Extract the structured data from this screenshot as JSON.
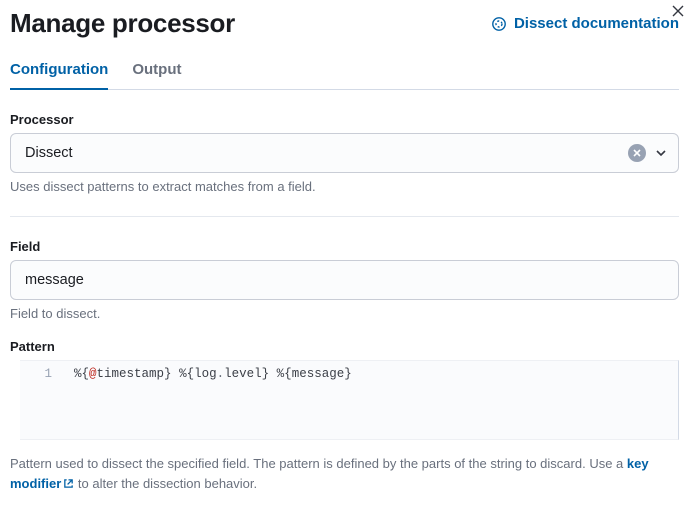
{
  "header": {
    "title": "Manage processor",
    "docLink": "Dissect documentation"
  },
  "tabs": {
    "configuration": "Configuration",
    "output": "Output"
  },
  "processor": {
    "label": "Processor",
    "value": "Dissect",
    "help": "Uses dissect patterns to extract matches from a field."
  },
  "field": {
    "label": "Field",
    "value": "message",
    "help": "Field to dissect."
  },
  "pattern": {
    "label": "Pattern",
    "lineNo": "1",
    "tokens": {
      "p1a": "%{",
      "at": "@",
      "ts": "timestamp",
      "p1b": "}",
      "sp1": " ",
      "p2a": "%{",
      "log": "log",
      "dot": ".",
      "level": "level",
      "p2b": "}",
      "sp2": " ",
      "p3a": "%{",
      "msg": "message",
      "p3b": "}"
    },
    "helpPrefix": "Pattern used to dissect the specified field. The pattern is defined by the parts of the string to discard. Use a ",
    "helpLink": "key modifier",
    "helpSuffix": " to alter the dissection behavior."
  }
}
